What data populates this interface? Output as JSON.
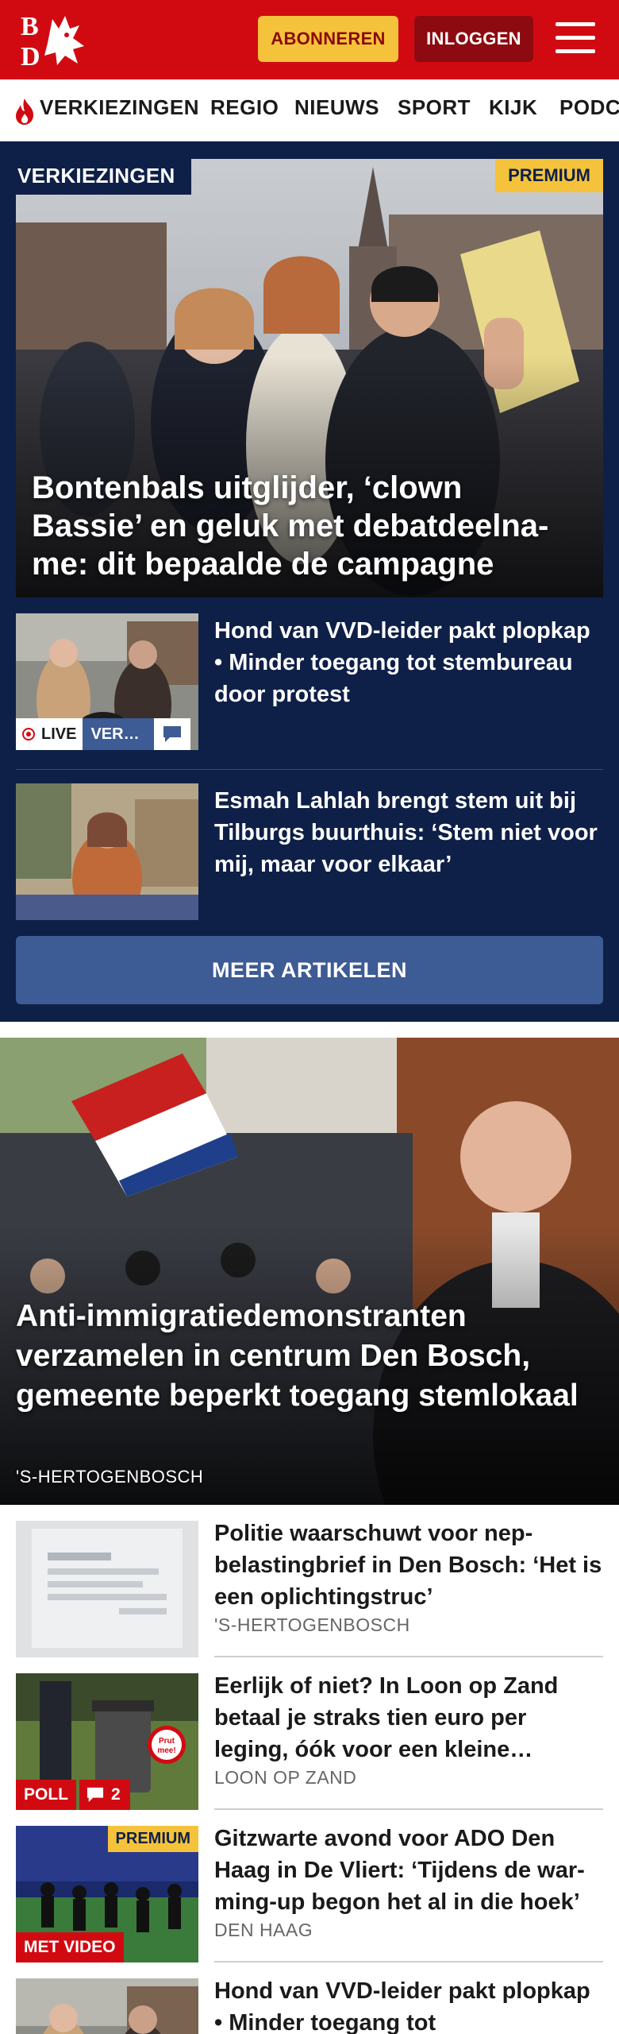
{
  "brand": {
    "logo_text": "BD",
    "colors": {
      "primary": "#d10a11",
      "navy": "#0e2048",
      "gold": "#f5c33b",
      "blue": "#3d5b94"
    }
  },
  "header": {
    "subscribe_label": "ABONNEREN",
    "login_label": "INLOGGEN",
    "menu_icon": "hamburger-menu-icon"
  },
  "nav": {
    "items": [
      {
        "label": "VERKIEZINGEN",
        "icon": "flame-icon"
      },
      {
        "label": "REGIO"
      },
      {
        "label": "NIEUWS"
      },
      {
        "label": "SPORT"
      },
      {
        "label": "KIJK"
      },
      {
        "label": "PODC"
      }
    ]
  },
  "election": {
    "section_label": "VERKIEZINGEN",
    "hero": {
      "badge": "PREMIUM",
      "title": "Bontenbals uitglijder, ‘clown Bassie’ en geluk met debatdeelna­me: dit bepaalde de campagne"
    },
    "articles": [
      {
        "title": "Hond van VVD-leider pakt plopkap • Minder toegang tot stembureau door protest",
        "live_label": "LIVE",
        "tag_label": "VER…",
        "comment_icon": "comment-icon"
      },
      {
        "title": "Esmah Lahlah brengt stem uit bij Tilburgs buurthuis: ‘Stem niet voor mij, maar voor elkaar’"
      }
    ],
    "more_label": "MEER ARTIKELEN"
  },
  "feature": {
    "title": "Anti-immigratiedemonstranten verzamelen in centrum Den Bosch, gemeente beperkt toegang stemlokaal",
    "location": "'S-HERTOGENBOSCH"
  },
  "list": [
    {
      "title": "Politie waarschuwt voor nep­belastingbrief in Den Bosch: ‘Het is een oplichtingstruc’",
      "location": "'S-HERTOGENBOSCH"
    },
    {
      "title": "Eerlijk of niet? In Loon op Zand betaal je straks tien euro per leging, óók voor een kleine…",
      "location": "LOON OP ZAND",
      "badge": "POLL",
      "comments": "2"
    },
    {
      "title": "Gitzwarte avond voor ADO Den Haag in De Vliert: ‘Tijdens de war­ming-up begon het al in die hoek’",
      "location": "DEN HAAG",
      "badge": "MET VIDEO",
      "premium": "PREMIUM"
    },
    {
      "title": "Hond van VVD-leider pakt plopkap • Minder toegang tot"
    }
  ]
}
